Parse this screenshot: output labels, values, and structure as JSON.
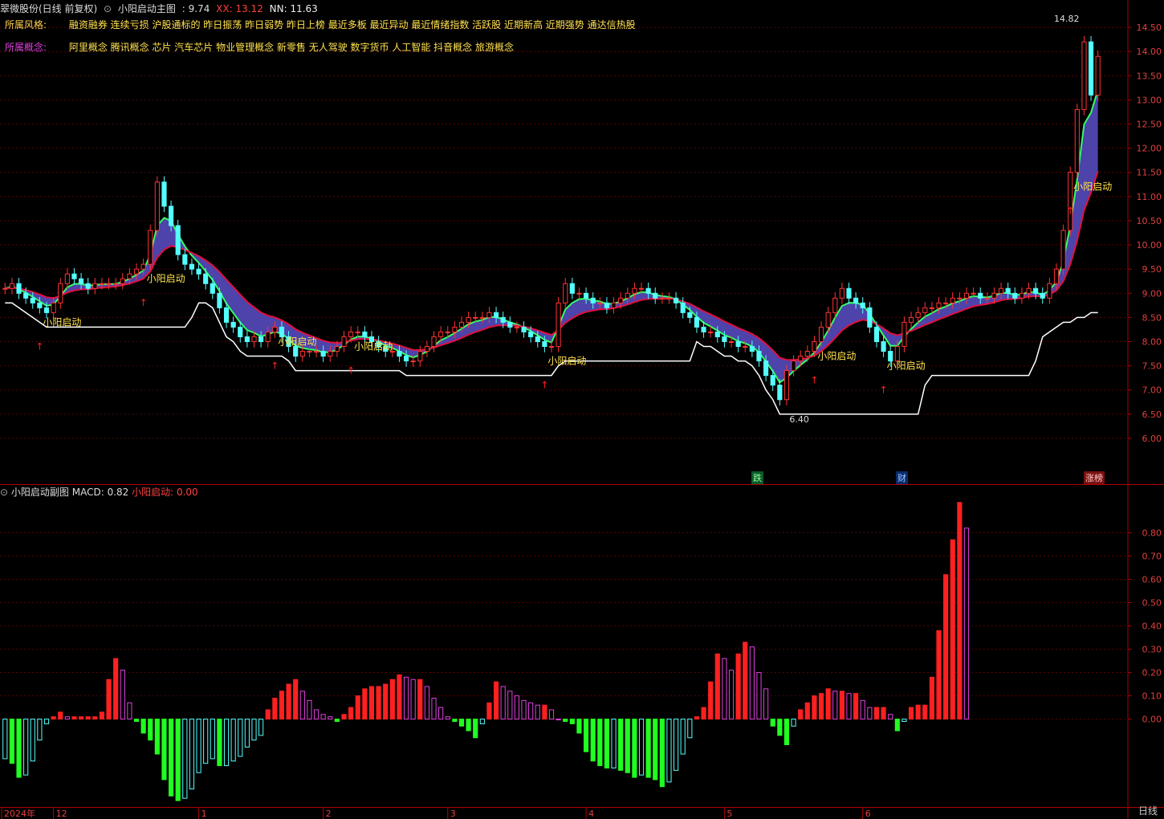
{
  "header": {
    "title": "翠微股份(日线 前复权)",
    "indicator": "小阳启动主图",
    "value": ": 9.74",
    "xx": "XX: 13.12",
    "nn": "NN: 11.63"
  },
  "style_row": {
    "label": "所属风格:",
    "items": "融资融券 连续亏损 沪股通标的 昨日振荡 昨日弱势 昨日上榜 最近多板 最近异动 最近情绪指数 活跃股 近期新高 近期强势 通达信热股"
  },
  "concept_row": {
    "label": "所属概念:",
    "items": "阿里概念 腾讯概念 芯片 汽车芯片 物业管理概念 新零售 无人驾驶 数字货币 人工智能 抖音概念 旅游概念"
  },
  "sub_header": {
    "title": "小阳启动副图",
    "macd": "MACD: 0.82",
    "signal": "小阳启动: 0.00"
  },
  "markers": {
    "high_price": "14.82",
    "low_price": "6.40",
    "start_label": "小阳启动",
    "tag_down": "跌",
    "tag_cai": "财",
    "tag_up": "涨榜"
  },
  "x_axis": [
    "2024年",
    "12",
    "1",
    "2",
    "3",
    "4",
    "5",
    "6"
  ],
  "period": "日线",
  "colors": {
    "up": "#ff3333",
    "down": "#54ffff",
    "ma": "#ffffff",
    "macd_up": "#ff2020",
    "macd_down": "#20ff20"
  },
  "chart_data": [
    {
      "type": "candlestick",
      "ylim": [
        5.6,
        14.9
      ],
      "yticks": [
        6.0,
        6.5,
        7.0,
        7.5,
        8.0,
        8.5,
        9.0,
        9.5,
        10.0,
        10.5,
        11.0,
        11.5,
        12.0,
        12.5,
        13.0,
        13.5,
        14.0,
        14.5
      ],
      "close": [
        9.1,
        9.2,
        9.0,
        8.9,
        8.8,
        8.7,
        8.6,
        8.8,
        9.2,
        9.4,
        9.3,
        9.2,
        9.1,
        9.2,
        9.2,
        9.2,
        9.2,
        9.3,
        9.4,
        9.5,
        9.6,
        10.3,
        11.3,
        10.8,
        10.4,
        9.8,
        9.6,
        9.5,
        9.4,
        9.2,
        9.0,
        8.7,
        8.4,
        8.3,
        8.1,
        8.0,
        8.1,
        8.0,
        8.2,
        8.3,
        8.1,
        7.9,
        7.7,
        7.8,
        7.8,
        7.8,
        7.7,
        7.8,
        7.9,
        8.1,
        8.2,
        8.2,
        8.1,
        8.0,
        7.9,
        7.8,
        7.8,
        7.7,
        7.6,
        7.6,
        7.8,
        7.9,
        8.1,
        8.2,
        8.2,
        8.3,
        8.4,
        8.5,
        8.5,
        8.5,
        8.6,
        8.5,
        8.4,
        8.3,
        8.3,
        8.2,
        8.1,
        8.0,
        7.9,
        7.9,
        8.8,
        9.2,
        9.0,
        9.0,
        8.9,
        8.8,
        8.8,
        8.7,
        8.8,
        8.9,
        9.0,
        9.1,
        9.1,
        9.0,
        8.9,
        8.9,
        8.9,
        8.8,
        8.6,
        8.5,
        8.3,
        8.2,
        8.2,
        8.1,
        8.0,
        8.0,
        7.9,
        7.9,
        7.8,
        7.6,
        7.3,
        7.1,
        6.8,
        7.4,
        7.6,
        7.7,
        7.8,
        8.0,
        8.3,
        8.6,
        8.9,
        9.1,
        8.9,
        8.8,
        8.7,
        8.3,
        8.0,
        7.8,
        7.6,
        7.9,
        8.4,
        8.5,
        8.6,
        8.7,
        8.7,
        8.8,
        8.8,
        8.9,
        8.9,
        9.0,
        9.0,
        8.9,
        8.9,
        9.0,
        9.1,
        9.0,
        8.9,
        9.0,
        9.1,
        9.0,
        8.9,
        9.2,
        9.5,
        10.3,
        11.5,
        12.8,
        14.2,
        13.1,
        13.9
      ],
      "title": "小阳启动主图"
    },
    {
      "type": "bar",
      "title": "小阳启动副图",
      "ylim": [
        -0.36,
        0.95
      ],
      "yticks": [
        0.0,
        0.1,
        0.2,
        0.3,
        0.4,
        0.5,
        0.6,
        0.7,
        0.8
      ],
      "values": [
        -0.17,
        -0.19,
        -0.25,
        -0.24,
        -0.18,
        -0.09,
        -0.02,
        0.01,
        0.03,
        0.01,
        0.01,
        0.01,
        0.01,
        0.01,
        0.03,
        0.17,
        0.26,
        0.21,
        0.07,
        -0.01,
        -0.06,
        -0.09,
        -0.15,
        -0.26,
        -0.33,
        -0.35,
        -0.34,
        -0.3,
        -0.23,
        -0.19,
        -0.17,
        -0.2,
        -0.2,
        -0.18,
        -0.16,
        -0.12,
        -0.09,
        -0.07,
        0.04,
        0.09,
        0.12,
        0.15,
        0.17,
        0.12,
        0.08,
        0.04,
        0.02,
        0.01,
        -0.01,
        0.02,
        0.05,
        0.1,
        0.13,
        0.14,
        0.14,
        0.15,
        0.17,
        0.19,
        0.18,
        0.17,
        0.17,
        0.14,
        0.09,
        0.05,
        0.01,
        -0.01,
        -0.03,
        -0.05,
        -0.08,
        -0.02,
        0.07,
        0.16,
        0.14,
        0.12,
        0.1,
        0.08,
        0.07,
        0.06,
        0.06,
        0.04,
        0.0,
        -0.01,
        -0.02,
        -0.06,
        -0.14,
        -0.18,
        -0.2,
        -0.21,
        -0.21,
        -0.22,
        -0.23,
        -0.25,
        -0.24,
        -0.25,
        -0.26,
        -0.29,
        -0.27,
        -0.22,
        -0.15,
        -0.08,
        0.01,
        0.05,
        0.16,
        0.28,
        0.26,
        0.21,
        0.28,
        0.33,
        0.31,
        0.2,
        0.13,
        -0.03,
        -0.07,
        -0.11,
        -0.03,
        0.04,
        0.07,
        0.1,
        0.11,
        0.13,
        0.12,
        0.12,
        0.11,
        0.11,
        0.08,
        0.05,
        0.05,
        0.05,
        0.02,
        -0.05,
        -0.01,
        0.05,
        0.06,
        0.06,
        0.18,
        0.38,
        0.62,
        0.77,
        0.93,
        0.82
      ]
    }
  ]
}
